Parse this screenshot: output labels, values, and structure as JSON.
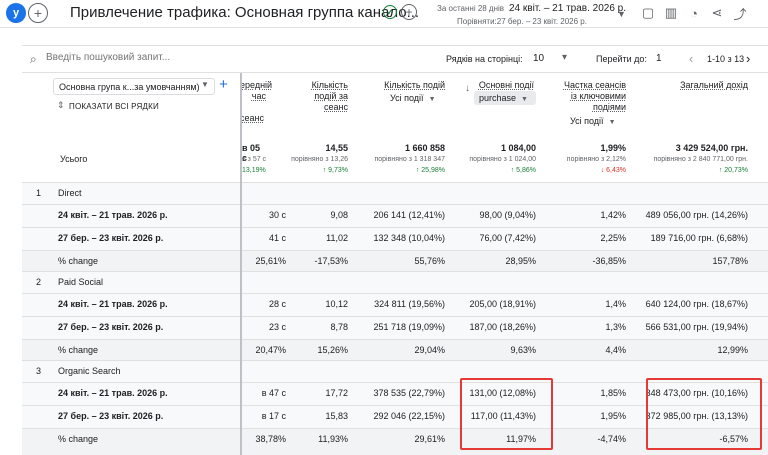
{
  "header": {
    "avatar": "у",
    "title": "Привлечение трафика: Основная группа канало...",
    "date_label": "За останні 28 днів",
    "date_main": "24 квіт. – 21 трав. 2026 р.",
    "date_compare": "Порівняти:27 бер. – 23 квіт. 2026 р."
  },
  "toolbar": {
    "search_placeholder": "Введіть пошуковий запит...",
    "rows_label": "Рядків на сторінці:",
    "rows_value": "10",
    "goto_label": "Перейти до:",
    "goto_value": "1",
    "range": "1-10 з 13"
  },
  "dimension": {
    "select": "Основна група к...за умовчанням)",
    "show_rows": "ПОКАЗАТИ ВСІ РЯДКИ",
    "total_label": "Усього"
  },
  "columns": {
    "c1": {
      "h1": "ередній",
      "h2": "час",
      "h3": "сеанс"
    },
    "c2": {
      "h1": "Кількість",
      "h2": "подій за",
      "h3": "сеанс"
    },
    "c3": {
      "h1": "Кількість подій",
      "sub": "Усі події"
    },
    "c4": {
      "h1": "Основні події",
      "chip": "purchase"
    },
    "c5": {
      "h1": "Частка сеансів",
      "h2": "із ключовими",
      "h3": "подіями",
      "sub": "Усі події"
    },
    "c6": {
      "h1": "Загальний дохід"
    }
  },
  "totals": {
    "c1": {
      "val": "в 05 с",
      "cmp": "в з 57 с",
      "chg": "13,19%"
    },
    "c2": {
      "val": "14,55",
      "cmp": "порівняно з 13,26",
      "chg": "↑ 9,73%"
    },
    "c3": {
      "val": "1 660 858",
      "cmp": "порівняно з 1 318 347",
      "chg": "↑ 25,98%"
    },
    "c4": {
      "val": "1 084,00",
      "cmp": "порівняно з 1 024,00",
      "chg": "↑ 5,86%"
    },
    "c5": {
      "val": "1,99%",
      "cmp": "порівняно з 2,12%",
      "chg": "↓ 6,43%"
    },
    "c6": {
      "val": "3 429 524,00 грн.",
      "cmp": "порівняно з 2 840 771,00 грн.",
      "chg": "↑ 20,73%"
    }
  },
  "rows": [
    {
      "kind": "group",
      "num": "1",
      "label": "Direct"
    },
    {
      "kind": "sub",
      "label": "24 квіт. – 21 трав. 2026 р.",
      "c1": "30 с",
      "c2": "9,08",
      "c3": "206 141 (12,41%)",
      "c4": "98,00 (9,04%)",
      "c5": "1,42%",
      "c6": "489 056,00 грн. (14,26%)"
    },
    {
      "kind": "sub",
      "label": "27 бер. – 23 квіт. 2026 р.",
      "c1": "41 с",
      "c2": "11,02",
      "c3": "132 348 (10,04%)",
      "c4": "76,00 (7,42%)",
      "c5": "2,25%",
      "c6": "189 716,00 грн. (6,68%)"
    },
    {
      "kind": "change",
      "label": "% change",
      "c1": "25,61%",
      "c2": "-17,53%",
      "c3": "55,76%",
      "c4": "28,95%",
      "c5": "-36,85%",
      "c6": "157,78%"
    },
    {
      "kind": "group",
      "num": "2",
      "label": "Paid Social"
    },
    {
      "kind": "sub",
      "label": "24 квіт. – 21 трав. 2026 р.",
      "c1": "28 с",
      "c2": "10,12",
      "c3": "324 811 (19,56%)",
      "c4": "205,00 (18,91%)",
      "c5": "1,4%",
      "c6": "640 124,00 грн. (18,67%)"
    },
    {
      "kind": "sub",
      "label": "27 бер. – 23 квіт. 2026 р.",
      "c1": "23 с",
      "c2": "8,78",
      "c3": "251 718 (19,09%)",
      "c4": "187,00 (18,26%)",
      "c5": "1,3%",
      "c6": "566 531,00 грн. (19,94%)"
    },
    {
      "kind": "change",
      "label": "% change",
      "c1": "20,47%",
      "c2": "15,26%",
      "c3": "29,04%",
      "c4": "9,63%",
      "c5": "4,4%",
      "c6": "12,99%"
    },
    {
      "kind": "group",
      "num": "3",
      "label": "Organic Search"
    },
    {
      "kind": "sub",
      "label": "24 квіт. – 21 трав. 2026 р.",
      "c1": "в 47 с",
      "c2": "17,72",
      "c3": "378 535 (22,79%)",
      "c4": "131,00 (12,08%)",
      "c5": "1,85%",
      "c6": "348 473,00 грн. (10,16%)"
    },
    {
      "kind": "sub",
      "label": "27 бер. – 23 квіт. 2026 р.",
      "c1": "в 17 с",
      "c2": "15,83",
      "c3": "292 046 (22,15%)",
      "c4": "117,00 (11,43%)",
      "c5": "1,95%",
      "c6": "372 985,00 грн. (13,13%)"
    },
    {
      "kind": "change",
      "label": "% change",
      "c1": "38,78%",
      "c2": "11,93%",
      "c3": "29,61%",
      "c4": "11,97%",
      "c5": "-4,74%",
      "c6": "-6,57%"
    }
  ]
}
